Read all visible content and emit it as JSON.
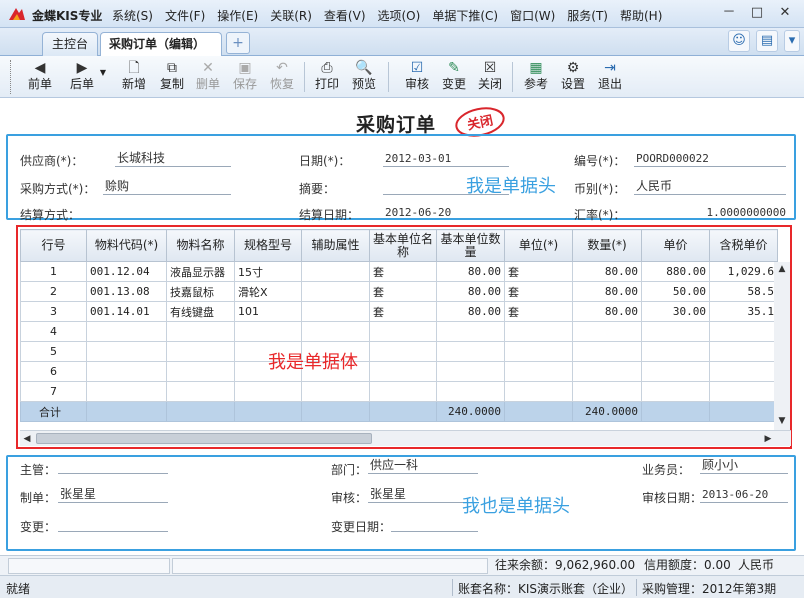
{
  "app": {
    "title": "金蝶KIS专业"
  },
  "menu": [
    "系统(S)",
    "文件(F)",
    "操作(E)",
    "关联(R)",
    "查看(V)",
    "选项(O)",
    "单据下推(C)",
    "窗口(W)",
    "服务(T)",
    "帮助(H)"
  ],
  "window_controls": {
    "minimize": "－",
    "restore": "□",
    "close": "✕"
  },
  "tabs": [
    {
      "label": "主控台"
    },
    {
      "label": "采购订单（编辑）",
      "close": "✕"
    }
  ],
  "tab_add": "+",
  "toolbar": {
    "prev": "前单",
    "next": "后单",
    "new": "新增",
    "copy": "复制",
    "delete": "删单",
    "save": "保存",
    "restore": "恢复",
    "print": "打印",
    "preview": "预览",
    "audit": "审核",
    "change": "变更",
    "close": "关闭",
    "reference": "参考",
    "settings": "设置",
    "exit": "退出"
  },
  "document": {
    "title": "采购订单",
    "stamp": "关闭"
  },
  "header": {
    "supplier_label": "供应商(*)：",
    "supplier_value": "长城科技",
    "date_label": "日期(*)：",
    "date_value": "2012-03-01",
    "number_label": "编号(*)：",
    "number_value": "POORD000022",
    "purchase_method_label": "采购方式(*)：",
    "purchase_method_value": "赊购",
    "summary_label": "摘要：",
    "summary_value": "",
    "currency_label": "币别(*)：",
    "currency_value": "人民币",
    "settlement_method_label": "结算方式：",
    "settlement_date_label": "结算日期：",
    "settlement_date_value": "2012-06-20",
    "exchange_rate_label": "汇率(*)：",
    "exchange_rate_value": "1.0000000000"
  },
  "annotations": {
    "header": "我是单据头",
    "body": "我是单据体",
    "footer": "我也是单据头"
  },
  "grid": {
    "columns": [
      "行号",
      "物料代码(*)",
      "物料名称",
      "规格型号",
      "辅助属性",
      "基本单位名称",
      "基本单位数量",
      "单位(*)",
      "数量(*)",
      "单价",
      "含税单价"
    ],
    "rows": [
      {
        "no": "1",
        "code": "001.12.04",
        "name": "液晶显示器",
        "spec": "15寸",
        "attr": "",
        "base_unit": "套",
        "base_qty": "80.00",
        "unit": "套",
        "qty": "80.00",
        "price": "880.00",
        "tax_price": "1,029.6"
      },
      {
        "no": "2",
        "code": "001.13.08",
        "name": "技嘉鼠标",
        "spec": "滑轮X",
        "attr": "",
        "base_unit": "套",
        "base_qty": "80.00",
        "unit": "套",
        "qty": "80.00",
        "price": "50.00",
        "tax_price": "58.5"
      },
      {
        "no": "3",
        "code": "001.14.01",
        "name": "有线键盘",
        "spec": "101",
        "attr": "",
        "base_unit": "套",
        "base_qty": "80.00",
        "unit": "套",
        "qty": "80.00",
        "price": "30.00",
        "tax_price": "35.1"
      },
      {
        "no": "4",
        "code": "",
        "name": "",
        "spec": "",
        "attr": "",
        "base_unit": "",
        "base_qty": "",
        "unit": "",
        "qty": "",
        "price": "",
        "tax_price": ""
      },
      {
        "no": "5",
        "code": "",
        "name": "",
        "spec": "",
        "attr": "",
        "base_unit": "",
        "base_qty": "",
        "unit": "",
        "qty": "",
        "price": "",
        "tax_price": ""
      },
      {
        "no": "6",
        "code": "",
        "name": "",
        "spec": "",
        "attr": "",
        "base_unit": "",
        "base_qty": "",
        "unit": "",
        "qty": "",
        "price": "",
        "tax_price": ""
      },
      {
        "no": "7",
        "code": "",
        "name": "",
        "spec": "",
        "attr": "",
        "base_unit": "",
        "base_qty": "",
        "unit": "",
        "qty": "",
        "price": "",
        "tax_price": ""
      }
    ],
    "total": {
      "label": "合计",
      "base_qty": "240.0000",
      "qty": "240.0000"
    }
  },
  "footer": {
    "manager_label": "主管：",
    "manager_value": "",
    "dept_label": "部门：",
    "dept_value": "供应一科",
    "salesman_label": "业务员：",
    "salesman_value": "顾小小",
    "maker_label": "制单：",
    "maker_value": "张星星",
    "auditor_label": "审核：",
    "auditor_value": "张星星",
    "audit_date_label": "审核日期：",
    "audit_date_value": "2013-06-20",
    "changer_label": "变更：",
    "changer_value": "",
    "change_date_label": "变更日期：",
    "change_date_value": ""
  },
  "status": {
    "balance": "往来余额：9,062,960.00",
    "credit": "信用额度：0.00",
    "currency": "人民币",
    "ready": "就绪",
    "account": "账套名称：KIS演示账套（企业）",
    "period": "采购管理：2012年第3期"
  },
  "colors": {
    "header_border": "#3aa0e0",
    "body_border": "#e8282a",
    "total_row": "#bcd3ea"
  }
}
